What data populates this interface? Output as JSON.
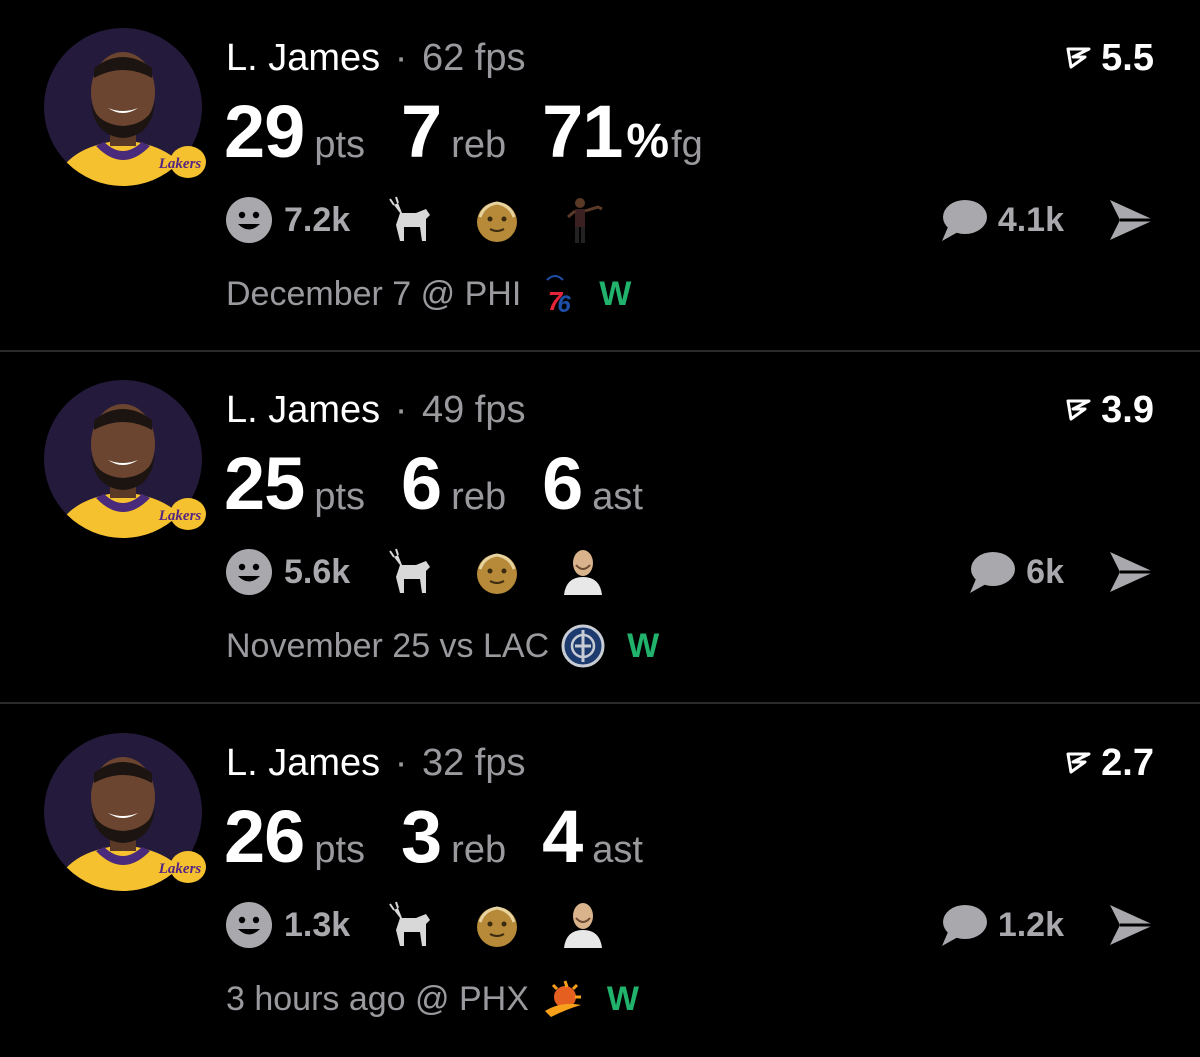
{
  "colors": {
    "background": "#000000",
    "muted": "#9a9a9e",
    "win": "#21b36b",
    "divider": "#2a2a2c"
  },
  "posts": [
    {
      "player": "L. James",
      "separator": "·",
      "fps_value": "62",
      "fps_unit": "fps",
      "score": "5.5",
      "score_icon": "pick-flag-icon",
      "stats": [
        {
          "value": "29",
          "unit": "pts"
        },
        {
          "value": "7",
          "unit": "reb"
        },
        {
          "value": "71",
          "pct": "%",
          "unit": "fg"
        }
      ],
      "reactions": {
        "count": "7.2k",
        "emojis": [
          "goat-emoji-icon",
          "old-man-emoji-icon",
          "dancing-man-sticker-icon"
        ]
      },
      "comments": "4.1k",
      "date": "December 7 @ PHI",
      "opponent_logo": "76ers-logo-icon",
      "result": "W"
    },
    {
      "player": "L. James",
      "separator": "·",
      "fps_value": "49",
      "fps_unit": "fps",
      "score": "3.9",
      "score_icon": "pick-flag-icon",
      "stats": [
        {
          "value": "25",
          "unit": "pts"
        },
        {
          "value": "6",
          "unit": "reb"
        },
        {
          "value": "6",
          "unit": "ast"
        }
      ],
      "reactions": {
        "count": "5.6k",
        "emojis": [
          "goat-emoji-icon",
          "old-man-emoji-icon",
          "bald-man-sticker-icon"
        ]
      },
      "comments": "6k",
      "date": "November 25 vs LAC",
      "opponent_logo": "clippers-logo-icon",
      "result": "W"
    },
    {
      "player": "L. James",
      "separator": "·",
      "fps_value": "32",
      "fps_unit": "fps",
      "score": "2.7",
      "score_icon": "pick-flag-icon",
      "stats": [
        {
          "value": "26",
          "unit": "pts"
        },
        {
          "value": "3",
          "unit": "reb"
        },
        {
          "value": "4",
          "unit": "ast"
        }
      ],
      "reactions": {
        "count": "1.3k",
        "emojis": [
          "goat-emoji-icon",
          "old-man-emoji-icon",
          "bald-man-sticker-icon"
        ]
      },
      "comments": "1.2k",
      "date": "3 hours ago @ PHX",
      "opponent_logo": "suns-logo-icon",
      "result": "W"
    }
  ]
}
